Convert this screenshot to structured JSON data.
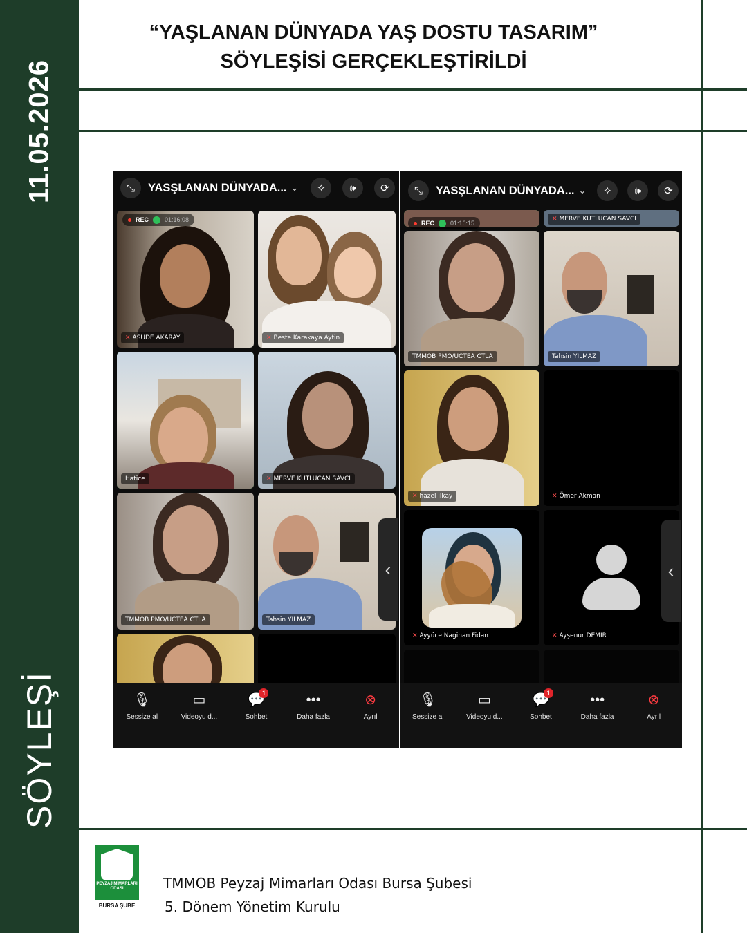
{
  "sidebar": {
    "date": "11.05.2026",
    "label": "SÖYLEŞİ"
  },
  "headline": {
    "line1": "“YAŞLANAN DÜNYADA YAŞ DOSTU TASARIM”",
    "line2": "SÖYLEŞİSİ GERÇEKLEŞTİRİLDİ"
  },
  "colors": {
    "brand_green": "#1e3d29",
    "logo_green": "#1c8f3b",
    "active_speaker": "#3dd26b",
    "leave_red": "#ff3b41"
  },
  "left_screen": {
    "meeting_title": "YASŞLANAN DÜNYADA...",
    "rec": {
      "label": "REC",
      "time": "01:16:08"
    },
    "tiles": [
      {
        "name": "ASUDE AKARAY",
        "muted": true
      },
      {
        "name": "Beste Karakaya Aytin",
        "muted": true
      },
      {
        "name": "Hatice",
        "muted": false
      },
      {
        "name": "MERVE KUTLUCAN SAVCI",
        "muted": true
      },
      {
        "name": "TMMOB PMO/UCTEA CTLA",
        "muted": false
      },
      {
        "name": "Tahsin YILMAZ",
        "muted": false
      }
    ]
  },
  "right_screen": {
    "meeting_title": "YASŞLANAN DÜNYADA...",
    "rec": {
      "label": "REC",
      "time": "01:16:15"
    },
    "top_partial_name": "MERVE KUTLUCAN SAVCI",
    "tiles": [
      {
        "name": "TMMOB PMO/UCTEA CTLA",
        "muted": false
      },
      {
        "name": "Tahsin YILMAZ",
        "muted": false
      },
      {
        "name": "hazel ilkay",
        "muted": true
      },
      {
        "name": "Ömer Akman",
        "muted": true
      },
      {
        "name": "Ayyüce Nagihan Fidan",
        "muted": true
      },
      {
        "name": "Ayşenur DEMİR",
        "muted": true
      }
    ]
  },
  "controls": [
    {
      "label": "Sessize al",
      "icon": "microphone-icon"
    },
    {
      "label": "Videoyu d...",
      "icon": "camera-icon"
    },
    {
      "label": "Sohbet",
      "icon": "chat-icon",
      "badge": "1"
    },
    {
      "label": "Daha fazla",
      "icon": "more-icon"
    },
    {
      "label": "Ayrıl",
      "icon": "leave-icon"
    }
  ],
  "footer": {
    "logo_text": "PEYZAJ MİMARLARI ODASI",
    "logo_sub": "BURSA ŞUBE",
    "line1": "TMMOB Peyzaj Mimarları Odası Bursa Şubesi",
    "line2": "5. Dönem Yönetim Kurulu"
  }
}
